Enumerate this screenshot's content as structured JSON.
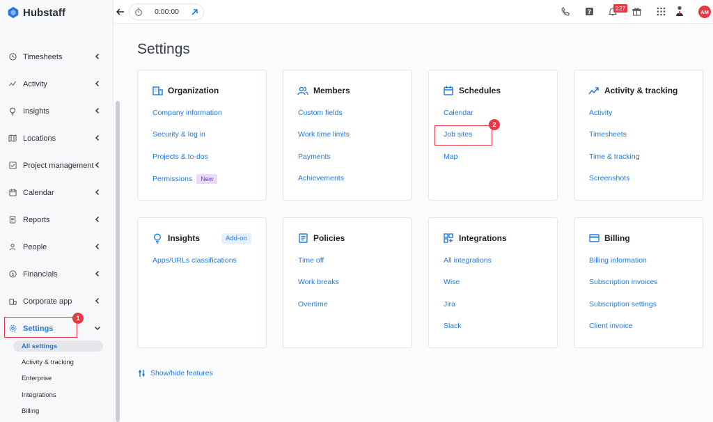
{
  "app": {
    "name": "Hubstaff"
  },
  "topbar": {
    "timer_value": "0:00:00",
    "notification_count": "227",
    "avatar_initials": "AM"
  },
  "sidebar": {
    "items": [
      {
        "label": "Timesheets"
      },
      {
        "label": "Activity"
      },
      {
        "label": "Insights"
      },
      {
        "label": "Locations"
      },
      {
        "label": "Project management"
      },
      {
        "label": "Calendar"
      },
      {
        "label": "Reports"
      },
      {
        "label": "People"
      },
      {
        "label": "Financials"
      },
      {
        "label": "Corporate app"
      },
      {
        "label": "Settings",
        "badge": "1"
      }
    ],
    "sub_items": [
      {
        "label": "All settings"
      },
      {
        "label": "Activity & tracking"
      },
      {
        "label": "Enterprise"
      },
      {
        "label": "Integrations"
      },
      {
        "label": "Billing"
      }
    ]
  },
  "main": {
    "title": "Settings",
    "cards": [
      {
        "title": "Organization",
        "links": [
          "Company information",
          "Security & log in",
          "Projects & to-dos",
          "Permissions"
        ],
        "pill": "New"
      },
      {
        "title": "Members",
        "links": [
          "Custom fields",
          "Work time limits",
          "Payments",
          "Achievements"
        ]
      },
      {
        "title": "Schedules",
        "links": [
          "Calendar",
          "Job sites",
          "Map"
        ],
        "badge": "2"
      },
      {
        "title": "Activity & tracking",
        "links": [
          "Activity",
          "Timesheets",
          "Time & tracking",
          "Screenshots"
        ]
      },
      {
        "title": "Insights",
        "links": [
          "Apps/URLs classifications"
        ],
        "addon": "Add-on"
      },
      {
        "title": "Policies",
        "links": [
          "Time off",
          "Work breaks",
          "Overtime"
        ]
      },
      {
        "title": "Integrations",
        "links": [
          "All integrations",
          "Wise",
          "Jira",
          "Slack"
        ]
      },
      {
        "title": "Billing",
        "links": [
          "Billing information",
          "Subscription invoices",
          "Subscription settings",
          "Client invoice"
        ]
      }
    ],
    "show_hide": "Show/hide features"
  },
  "colors": {
    "accent": "#1f7ae0",
    "highlight": "#e53946",
    "pill_new_bg": "#e9d9fb"
  }
}
